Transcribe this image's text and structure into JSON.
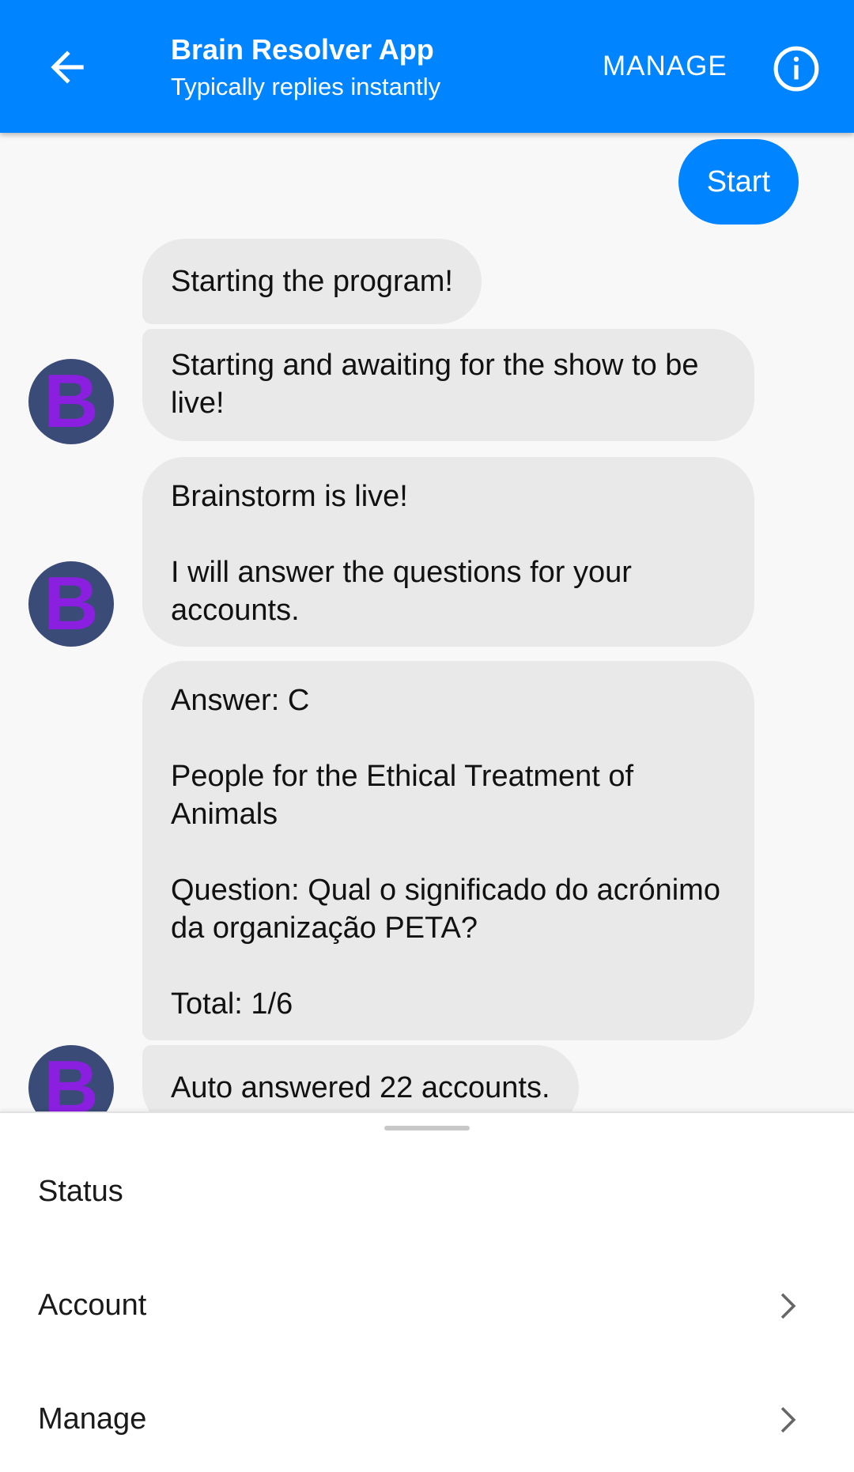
{
  "header": {
    "title": "Brain Resolver App",
    "subtitle": "Typically replies instantly",
    "manage_label": "MANAGE",
    "back_icon": "arrow-left-icon",
    "info_icon": "info-icon",
    "background_color": "#0084ff"
  },
  "chat": {
    "outgoing": [
      {
        "text": "Start"
      }
    ],
    "incoming": [
      {
        "text": "Starting the program!"
      },
      {
        "text": "Starting and awaiting for the show to be live!"
      },
      {
        "text": "Brainstorm is live!\n\nI will answer the questions for your accounts."
      },
      {
        "text": "Answer: C\n\nPeople for the Ethical Treatment of Animals\n\nQuestion: Qual o significado do acrónimo da organização PETA?\n\nTotal: 1/6"
      },
      {
        "text": "Auto answered 22 accounts."
      }
    ],
    "avatar_letter": "B",
    "outgoing_color": "#0084ff",
    "incoming_color": "#e9e9e9"
  },
  "menu": {
    "items": [
      {
        "label": "Status",
        "has_chevron": false
      },
      {
        "label": "Account",
        "has_chevron": true
      },
      {
        "label": "Manage",
        "has_chevron": true
      }
    ]
  }
}
